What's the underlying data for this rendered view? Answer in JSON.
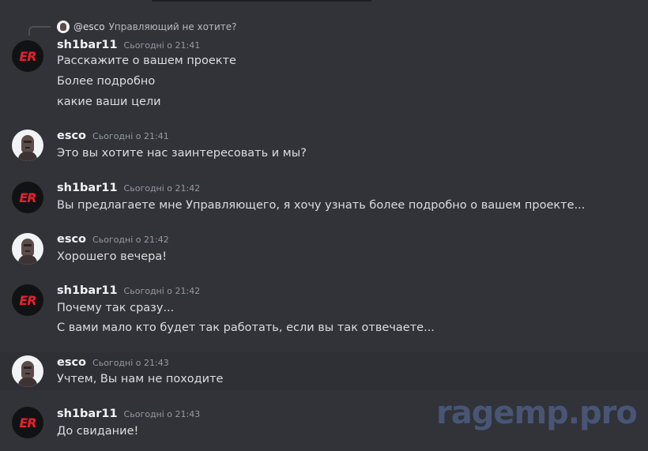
{
  "reply": {
    "user": "@esco",
    "text": "Управляющий не хотите?"
  },
  "messages": [
    {
      "user": "sh1bar11",
      "avatar_icon": "er-logo-avatar",
      "time": "Сьогодні о 21:41",
      "lines": [
        "Расскажите о вашем проекте",
        "Более подробно",
        "какие ваши цели"
      ]
    },
    {
      "user": "esco",
      "avatar_icon": "esco-avatar",
      "time": "Сьогодні о 21:41",
      "lines": [
        "Это вы хотите нас заинтересовать и мы?"
      ]
    },
    {
      "user": "sh1bar11",
      "avatar_icon": "er-logo-avatar",
      "time": "Сьогодні о 21:42",
      "lines": [
        "Вы предлагаете мне Управляющего, я хочу узнать более подробно о вашем проекте..."
      ]
    },
    {
      "user": "esco",
      "avatar_icon": "esco-avatar",
      "time": "Сьогодні о 21:42",
      "lines": [
        "Хорошего вечера!"
      ]
    },
    {
      "user": "sh1bar11",
      "avatar_icon": "er-logo-avatar",
      "time": "Сьогодні о 21:42",
      "lines": [
        "Почему так сразу...",
        "С вами мало кто будет так работать, если вы так отвечаете..."
      ]
    },
    {
      "user": "esco",
      "avatar_icon": "esco-avatar",
      "time": "Сьогодні о 21:43",
      "lines": [
        "Учтем, Вы нам не походите"
      ]
    },
    {
      "user": "sh1bar11",
      "avatar_icon": "er-logo-avatar",
      "time": "Сьогодні о 21:43",
      "lines": [
        "До свидание!"
      ]
    }
  ],
  "avatar_logo_text": "ER",
  "watermark": "ragemp.pro",
  "colors": {
    "background": "#313338",
    "highlight_row": "#2e3035",
    "logo_red": "#e8202e",
    "watermark": "#4a5779"
  }
}
